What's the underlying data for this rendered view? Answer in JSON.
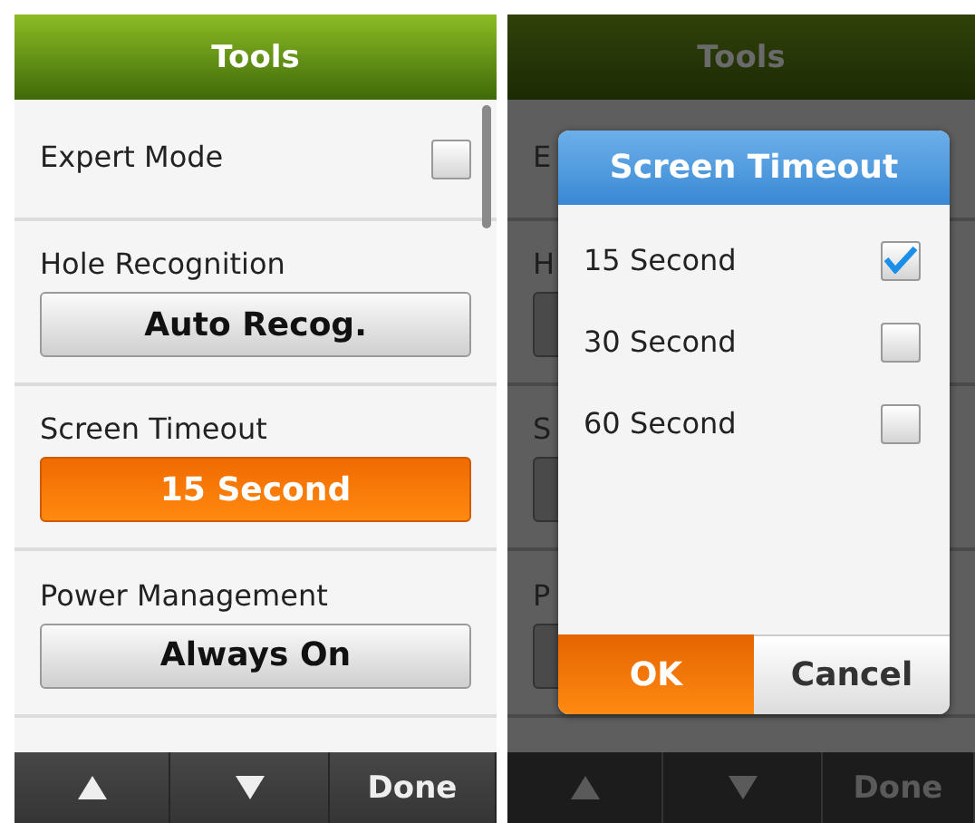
{
  "screens": [
    {
      "title": "Tools",
      "dimmed": false,
      "settings": [
        {
          "kind": "checkbox",
          "label": "Expert Mode",
          "checked": false
        },
        {
          "kind": "button",
          "label": "Hole Recognition",
          "value": "Auto Recog.",
          "highlighted": false
        },
        {
          "kind": "button",
          "label": "Screen Timeout",
          "value": "15 Second",
          "highlighted": true
        },
        {
          "kind": "button",
          "label": "Power Management",
          "value": "Always On",
          "highlighted": false
        }
      ],
      "footer": {
        "done": "Done"
      }
    },
    {
      "title": "Tools",
      "dimmed": true,
      "settings": [
        {
          "kind": "checkbox",
          "label": "E"
        },
        {
          "kind": "button",
          "label": "H"
        },
        {
          "kind": "button",
          "label": "S"
        },
        {
          "kind": "button",
          "label": "P"
        }
      ],
      "footer": {
        "done": "Done"
      },
      "dialog": {
        "title": "Screen Timeout",
        "options": [
          {
            "label": "15 Second",
            "selected": true
          },
          {
            "label": "30 Second",
            "selected": false
          },
          {
            "label": "60 Second",
            "selected": false
          }
        ],
        "ok": "OK",
        "cancel": "Cancel"
      }
    }
  ]
}
